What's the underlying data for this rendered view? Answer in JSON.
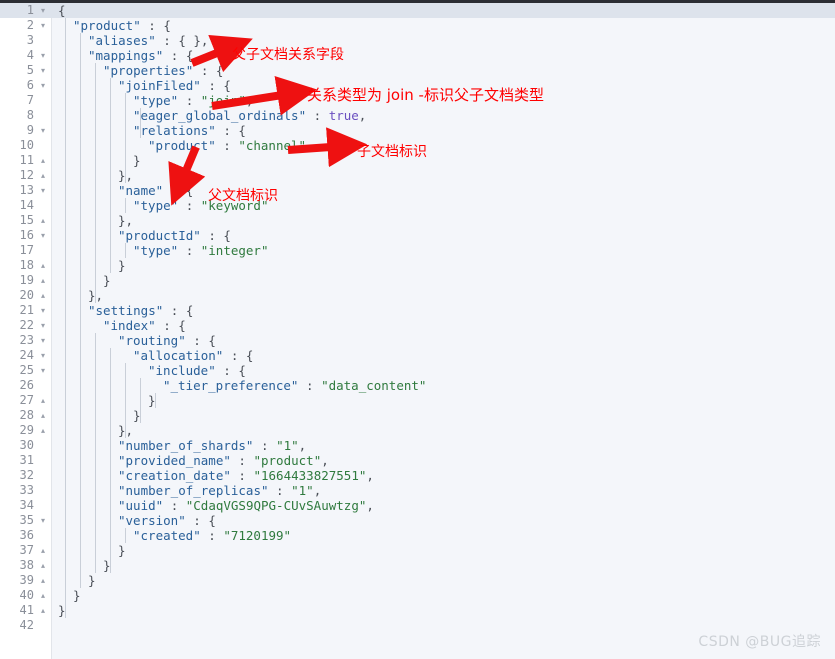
{
  "editor": {
    "language": "json",
    "total_lines": 42,
    "current_line": 1,
    "colors": {
      "background": "#f4f6fa",
      "gutter_background": "#ffffff",
      "current_line_highlight": "#dde3ec",
      "key": "#2a6099",
      "string": "#2f7a3e",
      "boolean": "#6a4fc0",
      "punctuation": "#4a4f57",
      "annotation": "#ff0000",
      "top_border": "#2b2d33"
    },
    "lines": [
      {
        "n": "1",
        "fold": "▾",
        "indent": 0,
        "text": "{"
      },
      {
        "n": "2",
        "fold": "▾",
        "indent": 1,
        "text": "\"product\" : {"
      },
      {
        "n": "3",
        "fold": "",
        "indent": 2,
        "text": "\"aliases\" : { },"
      },
      {
        "n": "4",
        "fold": "▾",
        "indent": 2,
        "text": "\"mappings\" : {"
      },
      {
        "n": "5",
        "fold": "▾",
        "indent": 3,
        "text": "\"properties\" : {"
      },
      {
        "n": "6",
        "fold": "▾",
        "indent": 4,
        "text": "\"joinFiled\" : {"
      },
      {
        "n": "7",
        "fold": "",
        "indent": 5,
        "text": "\"type\" : \"join\","
      },
      {
        "n": "8",
        "fold": "",
        "indent": 5,
        "text": "\"eager_global_ordinals\" : true,"
      },
      {
        "n": "9",
        "fold": "▾",
        "indent": 5,
        "text": "\"relations\" : {"
      },
      {
        "n": "10",
        "fold": "",
        "indent": 6,
        "text": "\"product\" : \"channel\""
      },
      {
        "n": "11",
        "fold": "▴",
        "indent": 5,
        "text": "}"
      },
      {
        "n": "12",
        "fold": "▴",
        "indent": 4,
        "text": "},"
      },
      {
        "n": "13",
        "fold": "▾",
        "indent": 4,
        "text": "\"name\" : {"
      },
      {
        "n": "14",
        "fold": "",
        "indent": 5,
        "text": "\"type\" : \"keyword\""
      },
      {
        "n": "15",
        "fold": "▴",
        "indent": 4,
        "text": "},"
      },
      {
        "n": "16",
        "fold": "▾",
        "indent": 4,
        "text": "\"productId\" : {"
      },
      {
        "n": "17",
        "fold": "",
        "indent": 5,
        "text": "\"type\" : \"integer\""
      },
      {
        "n": "18",
        "fold": "▴",
        "indent": 4,
        "text": "}"
      },
      {
        "n": "19",
        "fold": "▴",
        "indent": 3,
        "text": "}"
      },
      {
        "n": "20",
        "fold": "▴",
        "indent": 2,
        "text": "},"
      },
      {
        "n": "21",
        "fold": "▾",
        "indent": 2,
        "text": "\"settings\" : {"
      },
      {
        "n": "22",
        "fold": "▾",
        "indent": 3,
        "text": "\"index\" : {"
      },
      {
        "n": "23",
        "fold": "▾",
        "indent": 4,
        "text": "\"routing\" : {"
      },
      {
        "n": "24",
        "fold": "▾",
        "indent": 5,
        "text": "\"allocation\" : {"
      },
      {
        "n": "25",
        "fold": "▾",
        "indent": 6,
        "text": "\"include\" : {"
      },
      {
        "n": "26",
        "fold": "",
        "indent": 7,
        "text": "\"_tier_preference\" : \"data_content\""
      },
      {
        "n": "27",
        "fold": "▴",
        "indent": 6,
        "text": "}"
      },
      {
        "n": "28",
        "fold": "▴",
        "indent": 5,
        "text": "}"
      },
      {
        "n": "29",
        "fold": "▴",
        "indent": 4,
        "text": "},"
      },
      {
        "n": "30",
        "fold": "",
        "indent": 4,
        "text": "\"number_of_shards\" : \"1\","
      },
      {
        "n": "31",
        "fold": "",
        "indent": 4,
        "text": "\"provided_name\" : \"product\","
      },
      {
        "n": "32",
        "fold": "",
        "indent": 4,
        "text": "\"creation_date\" : \"1664433827551\","
      },
      {
        "n": "33",
        "fold": "",
        "indent": 4,
        "text": "\"number_of_replicas\" : \"1\","
      },
      {
        "n": "34",
        "fold": "",
        "indent": 4,
        "text": "\"uuid\" : \"CdaqVGS9QPG-CUvSAuwtzg\","
      },
      {
        "n": "35",
        "fold": "▾",
        "indent": 4,
        "text": "\"version\" : {"
      },
      {
        "n": "36",
        "fold": "",
        "indent": 5,
        "text": "\"created\" : \"7120199\""
      },
      {
        "n": "37",
        "fold": "▴",
        "indent": 4,
        "text": "}"
      },
      {
        "n": "38",
        "fold": "▴",
        "indent": 3,
        "text": "}"
      },
      {
        "n": "39",
        "fold": "▴",
        "indent": 2,
        "text": "}"
      },
      {
        "n": "40",
        "fold": "▴",
        "indent": 1,
        "text": "}"
      },
      {
        "n": "41",
        "fold": "▴",
        "indent": 0,
        "text": "}"
      },
      {
        "n": "42",
        "fold": "",
        "indent": 0,
        "text": ""
      }
    ]
  },
  "annotations": [
    {
      "id": "parent-child-relation-field",
      "text": "父子文档关系字段"
    },
    {
      "id": "relation-type-join",
      "text": "关系类型为 join -标识父子文档类型"
    },
    {
      "id": "child-doc-marker",
      "text": "子文档标识"
    },
    {
      "id": "parent-doc-marker",
      "text": "父文档标识"
    }
  ],
  "watermark": {
    "text": "CSDN @BUG追踪"
  }
}
